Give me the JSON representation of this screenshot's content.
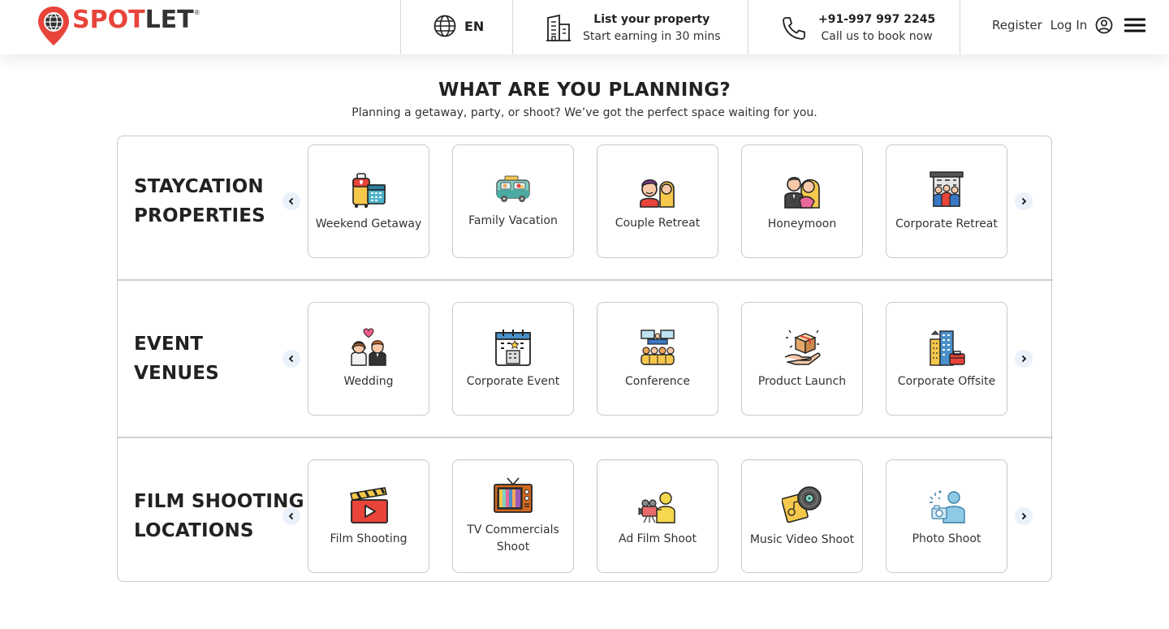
{
  "header": {
    "logo": {
      "spot": "SPOT",
      "let": "LET",
      "reg": "®"
    },
    "language": {
      "icon": "globe-icon",
      "label": "EN"
    },
    "list_property": {
      "icon": "building-icon",
      "title": "List your property",
      "subtitle": "Start earning in 30 mins"
    },
    "call": {
      "icon": "phone-icon",
      "title": "+91-997 997 2245",
      "subtitle": "Call us to book now"
    },
    "register_label": "Register",
    "login_label": "Log In",
    "account_icon": "user-circle-icon",
    "menu_icon": "hamburger-menu-icon"
  },
  "main": {
    "title": "WHAT ARE YOU PLANNING?",
    "subtitle": "Planning a getaway, party, or shoot? We’ve got the perfect space waiting for you."
  },
  "sections": [
    {
      "title_line1": "STAYCATION",
      "title_line2": "PROPERTIES",
      "items": [
        {
          "label": "Weekend Getaway",
          "icon": "luggage-calendar-icon"
        },
        {
          "label": "Family Vacation",
          "icon": "camper-van-icon"
        },
        {
          "label": "Couple Retreat",
          "icon": "couple-icon"
        },
        {
          "label": "Honeymoon",
          "icon": "embracing-couple-icon"
        },
        {
          "label": "Corporate Retreat",
          "icon": "office-team-icon"
        }
      ]
    },
    {
      "title_line1": "EVENT",
      "title_line2": "VENUES",
      "items": [
        {
          "label": "Wedding",
          "icon": "bride-groom-icon"
        },
        {
          "label": "Corporate Event",
          "icon": "calendar-building-icon"
        },
        {
          "label": "Conference",
          "icon": "conference-audience-icon"
        },
        {
          "label": "Product Launch",
          "icon": "hand-box-icon"
        },
        {
          "label": "Corporate Offsite",
          "icon": "city-briefcase-icon"
        }
      ]
    },
    {
      "title_line1": "FILM SHOOTING",
      "title_line2": "LOCATIONS",
      "items": [
        {
          "label": "Film Shooting",
          "icon": "clapperboard-icon"
        },
        {
          "label": "TV Commercials Shoot",
          "icon": "retro-tv-icon"
        },
        {
          "label": "Ad Film Shoot",
          "icon": "camera-operator-icon"
        },
        {
          "label": "Music Video Shoot",
          "icon": "vinyl-record-icon"
        },
        {
          "label": "Photo Shoot",
          "icon": "photographer-icon"
        }
      ]
    }
  ],
  "colors": {
    "brand_red": "#e8443a",
    "text_dark": "#222222",
    "border": "#c9c9c9",
    "arrow_bg": "#eaf1fb"
  }
}
